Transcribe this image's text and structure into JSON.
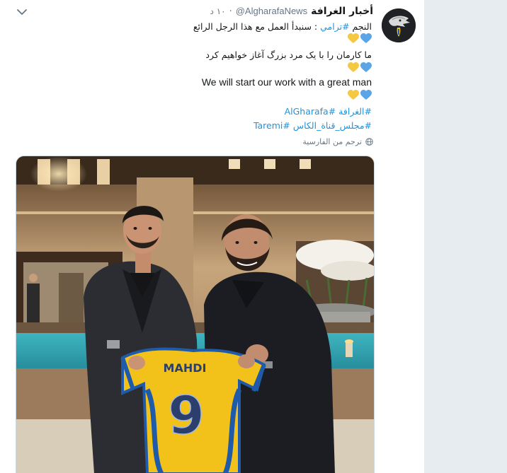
{
  "tweet": {
    "display_name": "أخبار الغرافة",
    "handle": "@AlgharafaNews",
    "separator": "·",
    "time": "١٠ د",
    "lines": {
      "line1_prefix": "النجم",
      "line1_hashtag": "#ترامي",
      "line1_suffix": ": سنبدأ العمل مع هذا الرجل الرائع",
      "line2": "ما کارمان را با یک مرد بزرگ آغاز خواهیم کرد",
      "line3": "We will start our work with a great man",
      "line4": "#الغرافة #AlGharafa",
      "line5": "#مجلس_قناة_الكاس #Taremi"
    },
    "heart_colors": [
      "#f5c842",
      "#5ba4e6"
    ],
    "translate_label": "ترجم من الفارسية",
    "media": {
      "jersey_name": "MAHDI",
      "jersey_number": "9",
      "jersey_color": "#f2c21b",
      "jersey_accent": "#1f5ba8"
    }
  },
  "icons": {
    "menu": "chevron-down-icon",
    "avatar": "team-crest-avatar",
    "heart": "heart-icon",
    "globe": "globe-icon"
  }
}
